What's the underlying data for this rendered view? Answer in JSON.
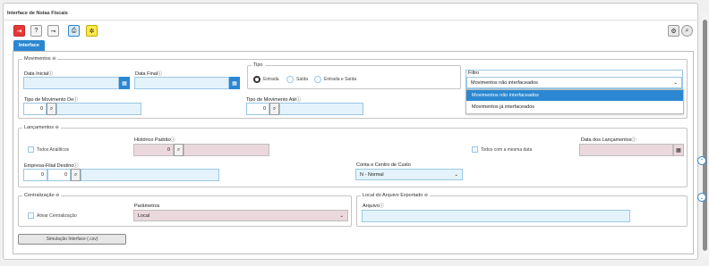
{
  "window": {
    "title": "Interface de Notas Fiscais"
  },
  "toolbar": {
    "exit_icon": "exit-icon",
    "help_icon": "help-icon",
    "print_icon": "print-icon",
    "settings_icon": "settings-icon"
  },
  "tab": {
    "label": "Interface"
  },
  "movimentos": {
    "legend": "Movimentos",
    "data_inicial_label": "Data Inicial",
    "data_final_label": "Data Final",
    "data_inicial_value": "",
    "data_final_value": "",
    "tipo_label": "Tipo",
    "tipo_options": [
      "Entrada",
      "Saída",
      "Entrada e Saída"
    ],
    "filtro_label": "Filtro",
    "filtro_selected": "Movimentos não interfaceados",
    "filtro_options": [
      "Movimentos não interfaceados",
      "Movimentos já interfaceados"
    ],
    "tipo_mov_de_label": "Tipo de Movimento De",
    "tipo_mov_de_value": "0",
    "tipo_mov_ate_label": "Tipo de Movimento Até",
    "tipo_mov_ate_value": "0"
  },
  "lancamentos": {
    "legend": "Lançamentos",
    "todos_analiticos": "Todos Analíticos",
    "historico_label": "Histórico Padrão",
    "historico_value": "0",
    "todos_mesma_data": "Todos com a mesma data",
    "data_lanc_label": "Data dos Lançamentos",
    "empresa_label": "Empresa-Filial Destino",
    "empresa_value1": "0",
    "empresa_value2": "0",
    "conta_label": "Conta e Centro de Custo",
    "conta_selected": "N - Normal"
  },
  "centralizacao": {
    "legend": "Centralização",
    "ativar": "Ativar Centralização",
    "parametros_label": "Parâmetros",
    "parametros_selected": "Local"
  },
  "arquivo": {
    "legend": "Local do Arquivo Exportado",
    "arquivo_label": "Arquivo"
  },
  "simulacao_button": "Simulação Interface (.csv)"
}
